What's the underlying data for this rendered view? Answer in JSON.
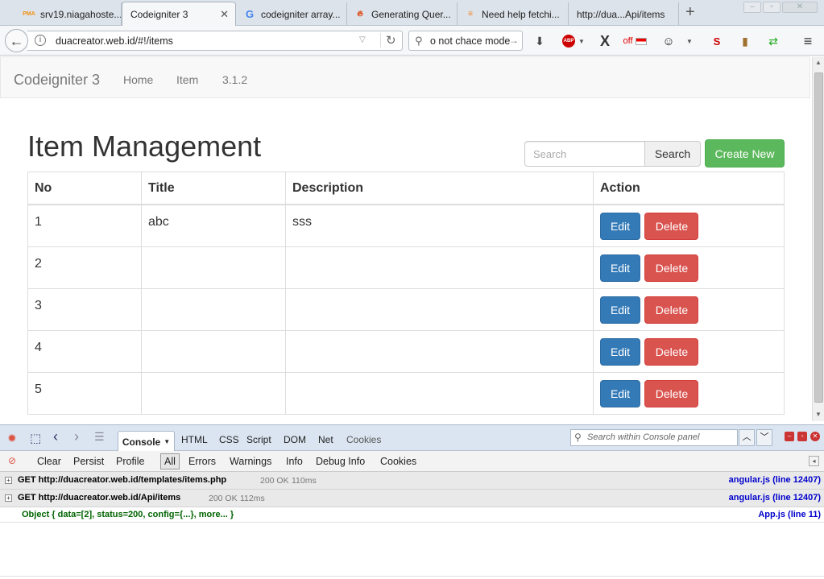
{
  "browser": {
    "tabs": [
      {
        "label": "srv19.niagahoste...",
        "favicon": "pma-icon",
        "active": false
      },
      {
        "label": "Codeigniter 3",
        "favicon": "none",
        "active": true
      },
      {
        "label": "codeigniter array...",
        "favicon": "google-icon",
        "active": false
      },
      {
        "label": "Generating Quer...",
        "favicon": "codeigniter-flame-icon",
        "active": false
      },
      {
        "label": "Need help fetchi...",
        "favicon": "stackoverflow-icon",
        "active": false
      },
      {
        "label": "http://dua...Api/items",
        "favicon": "none",
        "active": false
      }
    ],
    "url": "duacreator.web.id/#!/items",
    "search_value": "o not chace mode",
    "addon_off_label": "off"
  },
  "app": {
    "brand": "Codeigniter 3",
    "nav": [
      "Home",
      "Item",
      "3.1.2"
    ],
    "page_title": "Item Management",
    "search": {
      "placeholder": "Search",
      "button": "Search"
    },
    "create_button": "Create New",
    "table": {
      "headers": [
        "No",
        "Title",
        "Description",
        "Action"
      ],
      "rows": [
        {
          "no": "1",
          "title": "abc",
          "description": "sss"
        },
        {
          "no": "2",
          "title": "",
          "description": ""
        },
        {
          "no": "3",
          "title": "",
          "description": ""
        },
        {
          "no": "4",
          "title": "",
          "description": ""
        },
        {
          "no": "5",
          "title": "",
          "description": ""
        }
      ],
      "edit_label": "Edit",
      "delete_label": "Delete"
    }
  },
  "firebug": {
    "tabs": [
      "Console",
      "HTML",
      "CSS",
      "Script",
      "DOM",
      "Net",
      "Cookies"
    ],
    "search_placeholder": "Search within Console panel",
    "subtoolbar": [
      "Clear",
      "Persist",
      "Profile",
      "All",
      "Errors",
      "Warnings",
      "Info",
      "Debug Info",
      "Cookies"
    ],
    "logs": [
      {
        "request": "GET http://duacreator.web.id/templates/items.php",
        "status": "200 OK",
        "time": "110ms",
        "source": "angular.js (line 12407)"
      },
      {
        "request": "GET http://duacreator.web.id/Api/items",
        "status": "200 OK",
        "time": "112ms",
        "source": "angular.js (line 12407)"
      }
    ],
    "object_log": {
      "text": "Object { data=[2], status=200, config={...}, more... }",
      "source": "App.js (line 11)"
    }
  },
  "colors": {
    "primary": "#337ab7",
    "danger": "#d9534f",
    "success": "#5cb85c"
  }
}
